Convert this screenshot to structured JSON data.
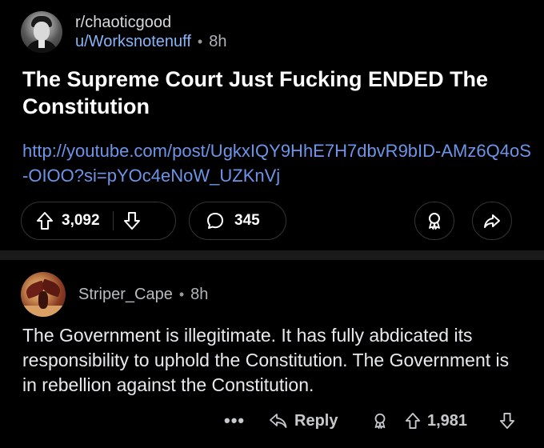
{
  "post": {
    "subreddit": "r/chaoticgood",
    "username": "u/Worksnotenuff",
    "separator": "•",
    "time": "8h",
    "title": "The Supreme Court Just Fucking ENDED The Constitution",
    "link": "http://youtube.com/post/UgkxIQY9HhE7H7dbvR9bID-AMz6Q4oS-OIOO?si=pYOc4eNoW_UZKnVj",
    "score": "3,092",
    "comments": "345"
  },
  "comment": {
    "author": "Striper_Cape",
    "separator": "•",
    "time": "8h",
    "body": "The Government is illegitimate. It has fully abdicated its responsibility to uphold the Constitution. The Government is in rebellion against the Constitution.",
    "more": "•••",
    "reply_label": "Reply",
    "score": "1,981"
  },
  "icons": {
    "upvote": "upvote-arrow-icon",
    "downvote": "downvote-arrow-icon",
    "comment": "speech-bubble-icon",
    "award": "award-ribbon-icon",
    "share": "share-arrow-icon",
    "reply": "reply-arrow-icon",
    "more": "more-dots-icon"
  },
  "colors": {
    "background": "#000000",
    "link": "#6e94e8",
    "username": "#8ab4f8",
    "title": "#ffffff",
    "border": "#343536",
    "separator_band": "#1a1a1b"
  }
}
